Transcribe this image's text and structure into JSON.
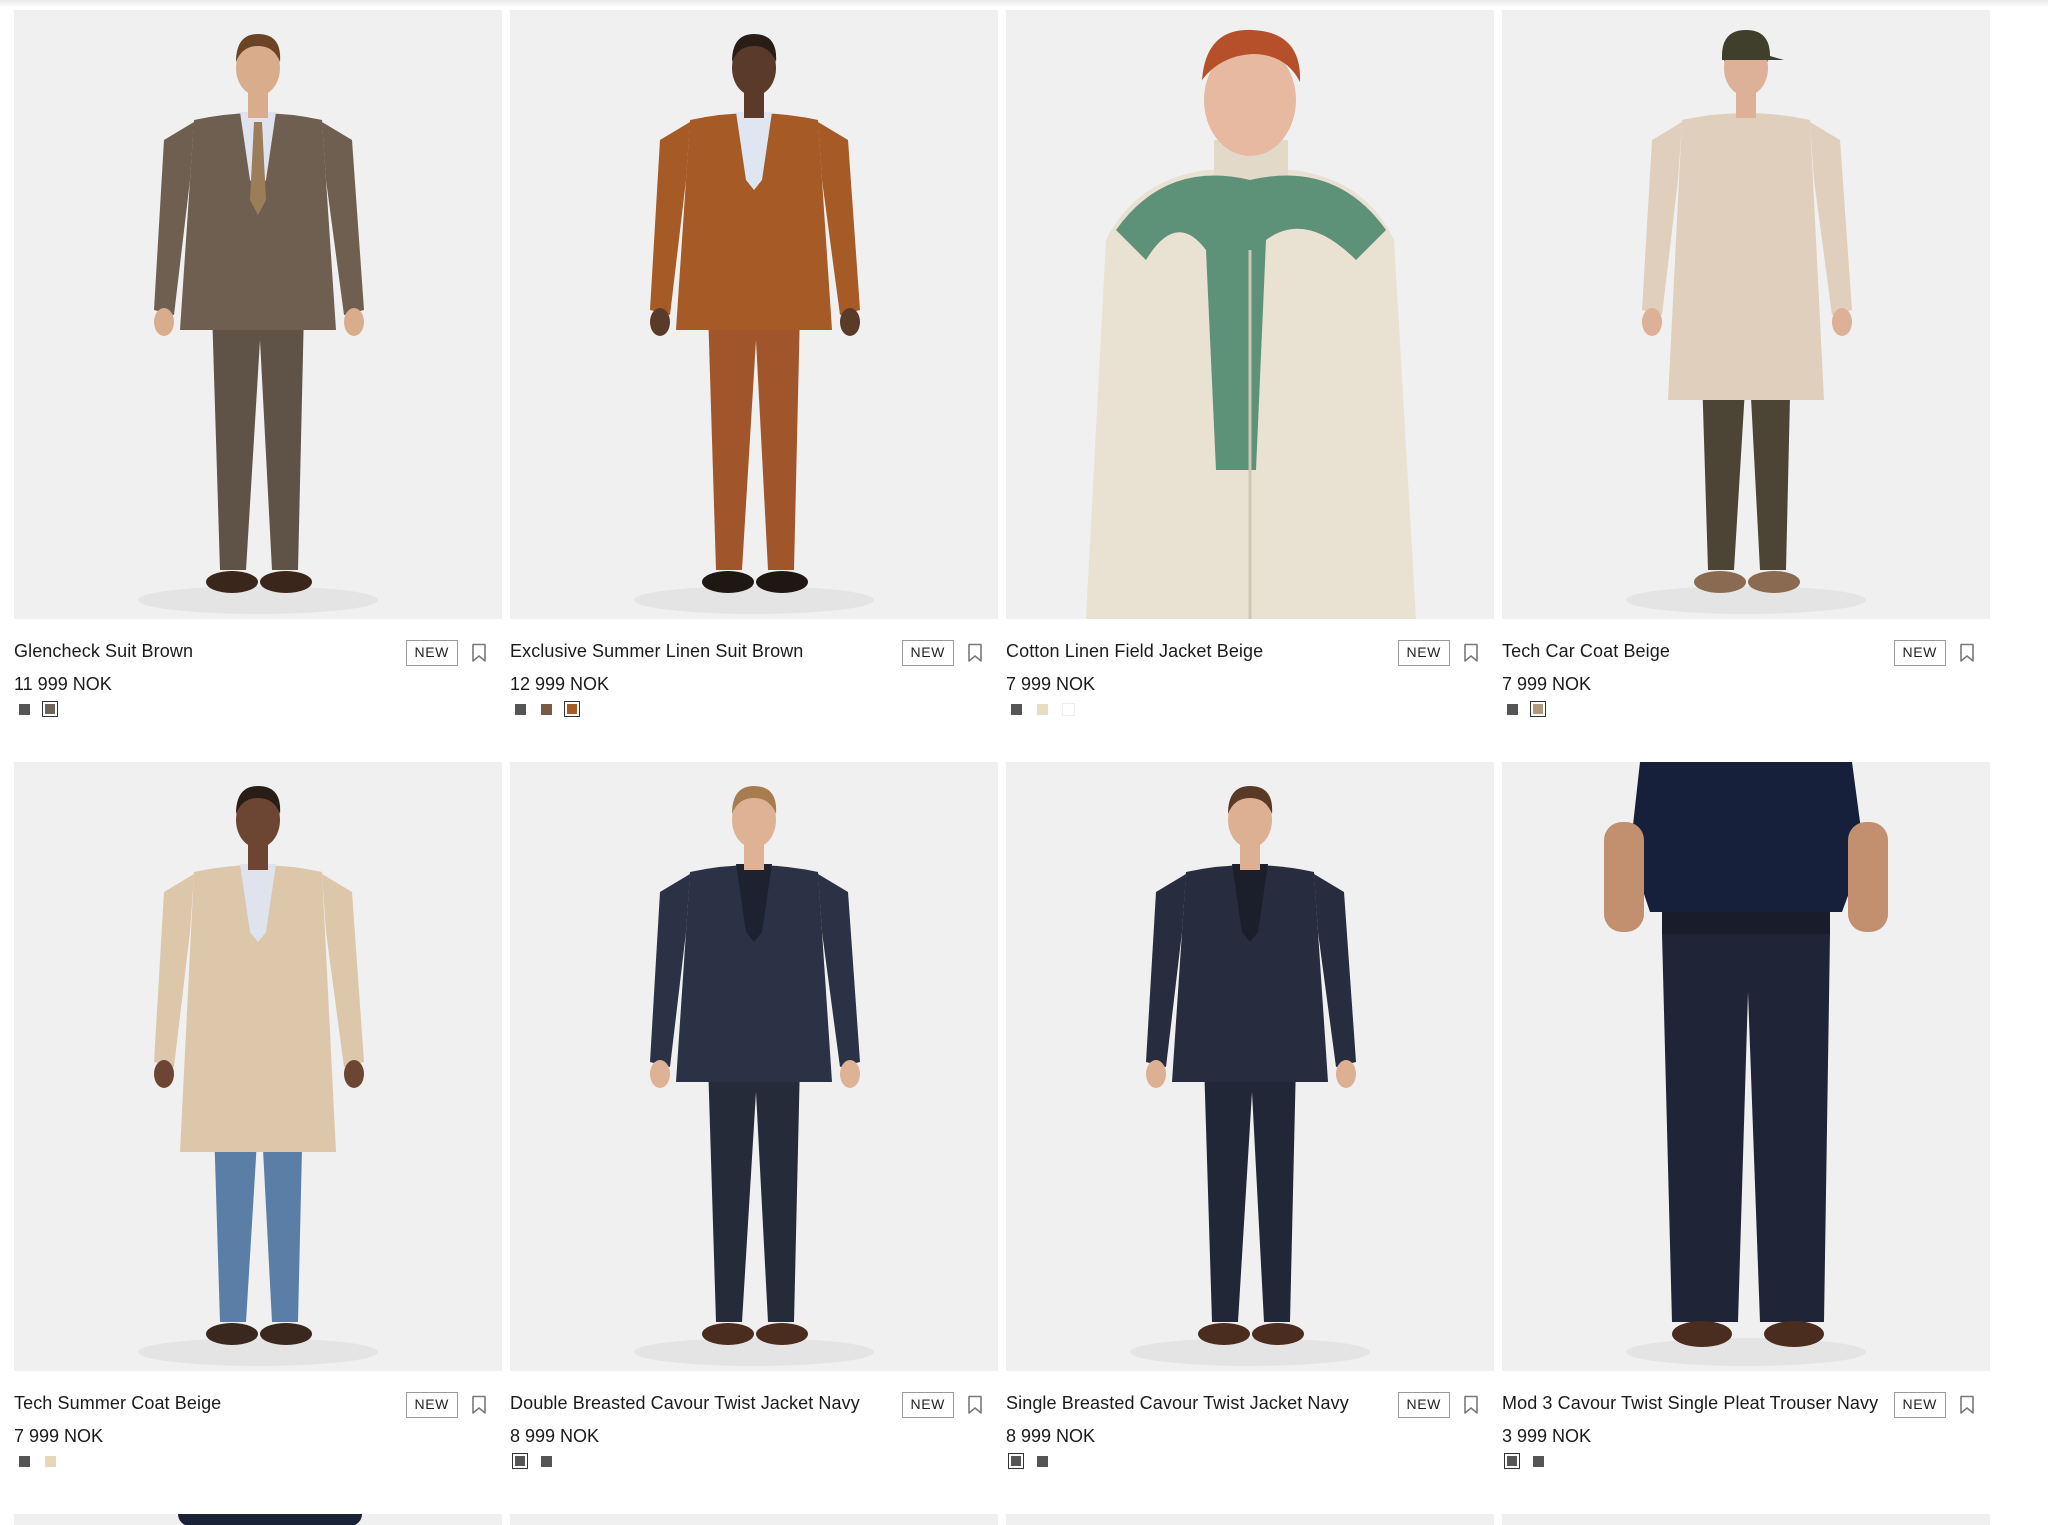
{
  "currency_note": "NOK",
  "products": [
    {
      "title": "Glencheck Suit Brown",
      "price": "11 999 NOK",
      "badge": "NEW",
      "model": {
        "skin": "#d9ad8c",
        "hair": "#6b4426",
        "jacket": "#6f5f51",
        "trousers": "#5f5246",
        "shirt": "#dfe3ee",
        "shoes": "#3b261c",
        "tie": "#9b7d59"
      },
      "swatches": [
        {
          "color": "#555555",
          "selected": false
        },
        {
          "color": "#6f6459",
          "selected": true
        }
      ]
    },
    {
      "title": "Exclusive Summer Linen Suit Brown",
      "price": "12 999 NOK",
      "badge": "NEW",
      "model": {
        "skin": "#5a3a28",
        "hair": "#2a1d16",
        "jacket": "#a65a25",
        "trousers": "#a0562a",
        "shirt": "#dfe6f2",
        "shoes": "#1e1714"
      },
      "swatches": [
        {
          "color": "#555555",
          "selected": false
        },
        {
          "color": "#7a5a44",
          "selected": false
        },
        {
          "color": "#a65a25",
          "selected": true
        }
      ]
    },
    {
      "title": "Cotton Linen Field Jacket Beige",
      "price": "7 999 NOK",
      "badge": "NEW",
      "model": {
        "skin": "#e6b9a0",
        "hair": "#b5502a",
        "jacket": "#e9e1d2",
        "trousers": "#e2d9c8",
        "scarf": "#5d9278"
      },
      "swatches": [
        {
          "color": "#555555",
          "selected": false
        },
        {
          "color": "#e8dcc3",
          "selected": false
        },
        {
          "color": "#ffffff",
          "selected": false
        }
      ]
    },
    {
      "title": "Tech Car Coat Beige",
      "price": "7 999 NOK",
      "badge": "NEW",
      "model": {
        "skin": "#dcb197",
        "hair": "#4e4a3a",
        "jacket": "#e0cfbc",
        "trousers": "#4c4536",
        "shoes": "#8a6a50",
        "cap": "#3f3f2c"
      },
      "swatches": [
        {
          "color": "#555555",
          "selected": false
        },
        {
          "color": "#b09a7e",
          "selected": true
        }
      ]
    },
    {
      "title": "Tech Summer Coat Beige",
      "price": "7 999 NOK",
      "badge": "NEW",
      "model": {
        "skin": "#6d4633",
        "hair": "#2a1d16",
        "jacket": "#ddc7ab",
        "trousers": "#5b7ea7",
        "shoes": "#3a271d",
        "shirt": "#dfe3ee"
      },
      "swatches": [
        {
          "color": "#555555",
          "selected": false
        },
        {
          "color": "#e8d6bb",
          "selected": false
        }
      ]
    },
    {
      "title": "Double Breasted Cavour Twist Jacket Navy",
      "price": "8 999 NOK",
      "badge": "NEW",
      "model": {
        "skin": "#dfb296",
        "hair": "#a77c4e",
        "jacket": "#2c3246",
        "trousers": "#262b3a",
        "shirt": "#1d2130",
        "shoes": "#4a2d1e"
      },
      "swatches": [
        {
          "color": "#555555",
          "selected": true
        },
        {
          "color": "#555555",
          "selected": false
        }
      ]
    },
    {
      "title": "Single Breasted Cavour Twist Jacket Navy",
      "price": "8 999 NOK",
      "badge": "NEW",
      "model": {
        "skin": "#ddaf93",
        "hair": "#5a3a24",
        "jacket": "#272c3e",
        "trousers": "#222737",
        "shirt": "#1b1f2c",
        "shoes": "#4a2d1e"
      },
      "swatches": [
        {
          "color": "#555555",
          "selected": true
        },
        {
          "color": "#555555",
          "selected": false
        }
      ]
    },
    {
      "title": "Mod 3 Cavour Twist Single Pleat Trouser Navy",
      "price": "3 999 NOK",
      "badge": "NEW",
      "model": {
        "skin": "#c28f6f",
        "jacket": "#17203a",
        "trousers": "#1f2436",
        "shoes": "#4a2d1e"
      },
      "swatches": [
        {
          "color": "#555555",
          "selected": true
        },
        {
          "color": "#555555",
          "selected": false
        }
      ]
    }
  ],
  "partial_row_tops": [
    {
      "accent": "#1a2238"
    },
    {},
    {},
    {}
  ]
}
